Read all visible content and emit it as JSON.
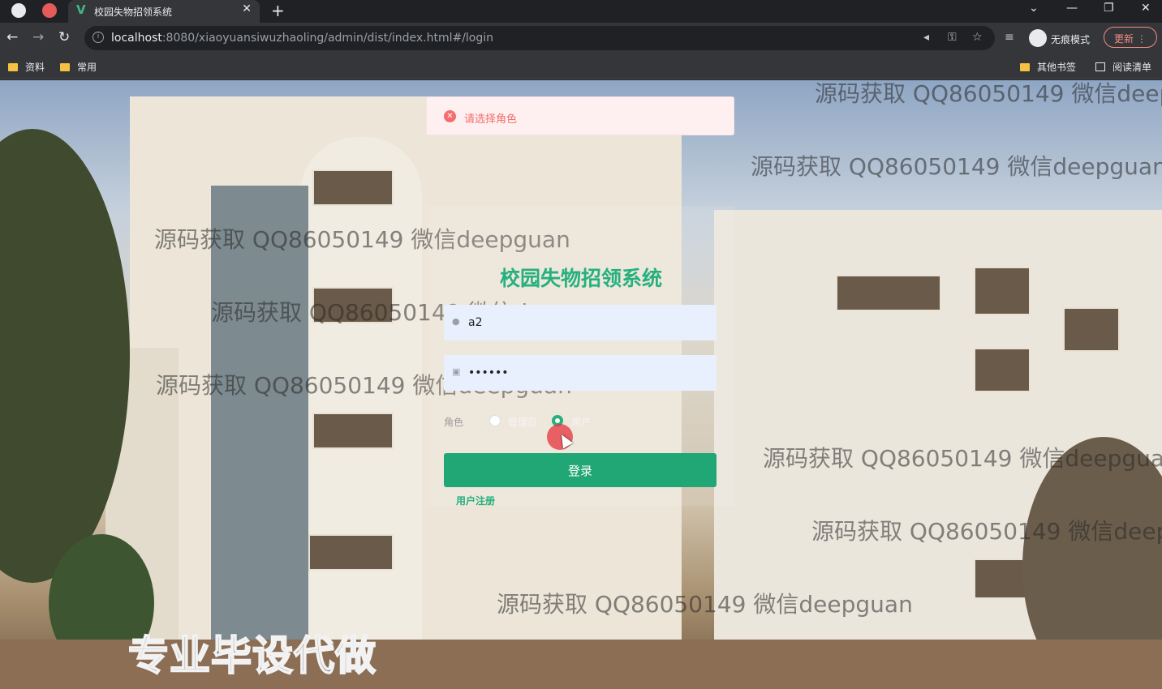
{
  "browser": {
    "tab_title": "校园失物招领系统",
    "url_host": "localhost",
    "url_path": ":8080/xiaoyuansiwuzhaoling/admin/dist/index.html#/login",
    "incognito_label": "无痕模式",
    "update_label": "更新",
    "bookmarks": [
      "资料",
      "常用"
    ],
    "bookmarks_right": [
      "其他书签",
      "阅读清单"
    ]
  },
  "alert": {
    "message": "请选择角色",
    "type": "error"
  },
  "login": {
    "title": "校园失物招领系统",
    "username_value": "a2",
    "password_value": "••••••",
    "role_label": "角色",
    "roles": [
      "管理员",
      "用户"
    ],
    "selected_role": "用户",
    "login_button": "登录",
    "register_link": "用户注册"
  },
  "watermark_text": "源码获取 QQ86050149 微信deepguan",
  "banner_text": "专业毕设代做",
  "colors": {
    "accent": "#21a675",
    "error": "#f56c6c"
  }
}
